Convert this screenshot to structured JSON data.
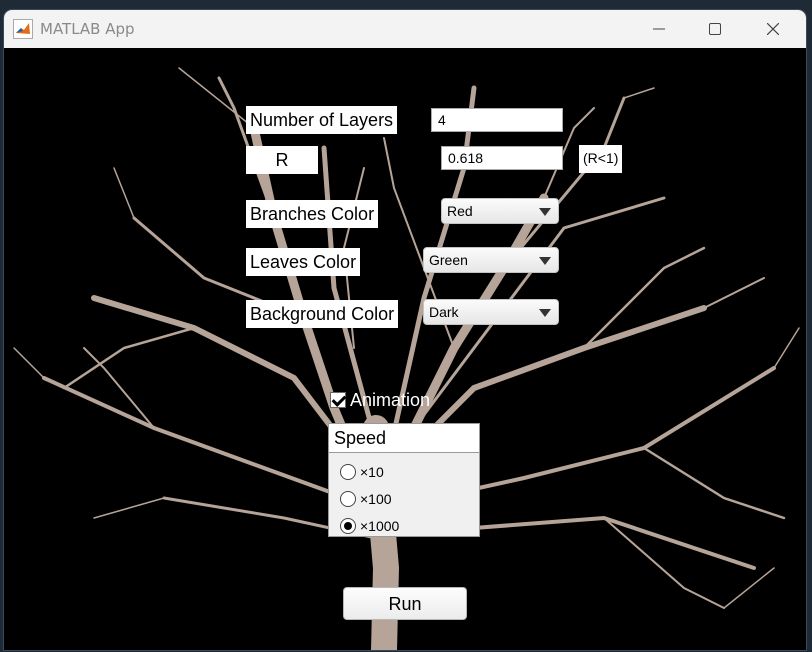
{
  "window": {
    "title": "MATLAB App",
    "controls": [
      "minimize",
      "maximize",
      "close"
    ]
  },
  "form": {
    "layers_label": "Number of Layers",
    "layers_value": "4",
    "r_label": "R",
    "r_value": "0.618",
    "r_hint": "(R<1)",
    "branches_label": "Branches Color",
    "branches_value": "Red",
    "leaves_label": "Leaves Color",
    "leaves_value": "Green",
    "background_label": "Background Color",
    "background_value": "Dark",
    "animation_label": "Animation",
    "animation_checked": true
  },
  "speed": {
    "title": "Speed",
    "options": [
      "×10",
      "×100",
      "×1000"
    ],
    "selected": "×1000"
  },
  "run_label": "Run",
  "colors": {
    "canvas": "#000000",
    "titlebar": "#f3f3f3",
    "branch": "#b5a497"
  },
  "icons": {
    "app": "matlab-logo-icon",
    "minimize": "minimize-icon",
    "maximize": "maximize-icon",
    "close": "close-icon",
    "dropdown": "chevron-down-icon"
  }
}
